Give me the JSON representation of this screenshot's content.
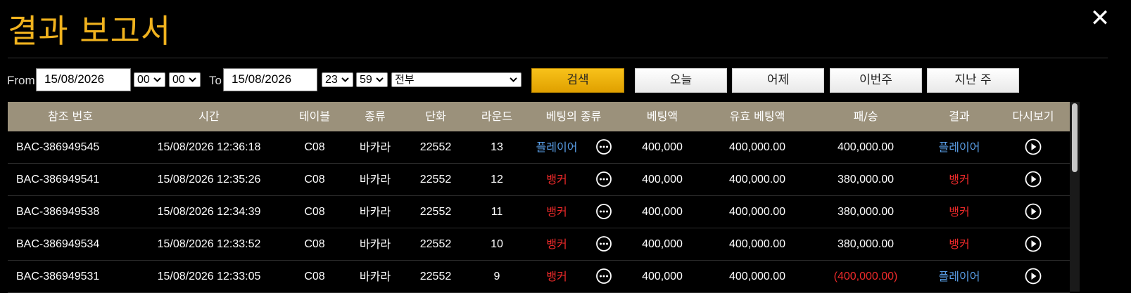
{
  "header": {
    "title": "결과 보고서",
    "close": "✕"
  },
  "filters": {
    "from_label": "From",
    "from_date": "15/08/2026",
    "from_hour": "00",
    "from_minute": "00",
    "to_label": "To",
    "to_date": "15/08/2026",
    "to_hour": "23",
    "to_minute": "59",
    "game_select": "전부",
    "search_button": "검색",
    "quick_buttons": [
      "오늘",
      "어제",
      "이번주",
      "지난 주"
    ]
  },
  "table": {
    "columns": [
      "참조 번호",
      "시간",
      "테이블",
      "종류",
      "단화",
      "라운드",
      "베팅의 종류",
      "베팅액",
      "유효 베팅액",
      "패/승",
      "결과",
      "다시보기"
    ],
    "rows": [
      {
        "ref": "BAC-386949545",
        "time": "15/08/2026 12:36:18",
        "table": "C08",
        "type": "바카라",
        "shoe": "22552",
        "round": "13",
        "bet_type": "플레이어",
        "bet_type_color": "blue",
        "bet": "400,000",
        "valid_bet": "400,000.00",
        "win_loss": "400,000.00",
        "win_loss_color": "white",
        "result": "플레이어",
        "result_color": "blue"
      },
      {
        "ref": "BAC-386949541",
        "time": "15/08/2026 12:35:26",
        "table": "C08",
        "type": "바카라",
        "shoe": "22552",
        "round": "12",
        "bet_type": "뱅커",
        "bet_type_color": "red",
        "bet": "400,000",
        "valid_bet": "400,000.00",
        "win_loss": "380,000.00",
        "win_loss_color": "white",
        "result": "뱅커",
        "result_color": "red"
      },
      {
        "ref": "BAC-386949538",
        "time": "15/08/2026 12:34:39",
        "table": "C08",
        "type": "바카라",
        "shoe": "22552",
        "round": "11",
        "bet_type": "뱅커",
        "bet_type_color": "red",
        "bet": "400,000",
        "valid_bet": "400,000.00",
        "win_loss": "380,000.00",
        "win_loss_color": "white",
        "result": "뱅커",
        "result_color": "red"
      },
      {
        "ref": "BAC-386949534",
        "time": "15/08/2026 12:33:52",
        "table": "C08",
        "type": "바카라",
        "shoe": "22552",
        "round": "10",
        "bet_type": "뱅커",
        "bet_type_color": "red",
        "bet": "400,000",
        "valid_bet": "400,000.00",
        "win_loss": "380,000.00",
        "win_loss_color": "white",
        "result": "뱅커",
        "result_color": "red"
      },
      {
        "ref": "BAC-386949531",
        "time": "15/08/2026 12:33:05",
        "table": "C08",
        "type": "바카라",
        "shoe": "22552",
        "round": "9",
        "bet_type": "뱅커",
        "bet_type_color": "red",
        "bet": "400,000",
        "valid_bet": "400,000.00",
        "win_loss": "(400,000.00)",
        "win_loss_color": "red",
        "result": "플레이어",
        "result_color": "blue"
      }
    ]
  },
  "colors": {
    "accent": "#f0b21e",
    "header_bg": "#9b917b",
    "player": "#5a9fe8",
    "banker": "#ee2a2a"
  },
  "icons": {
    "more": "more-dots-icon",
    "replay": "play-circle-icon",
    "close": "close-icon"
  }
}
